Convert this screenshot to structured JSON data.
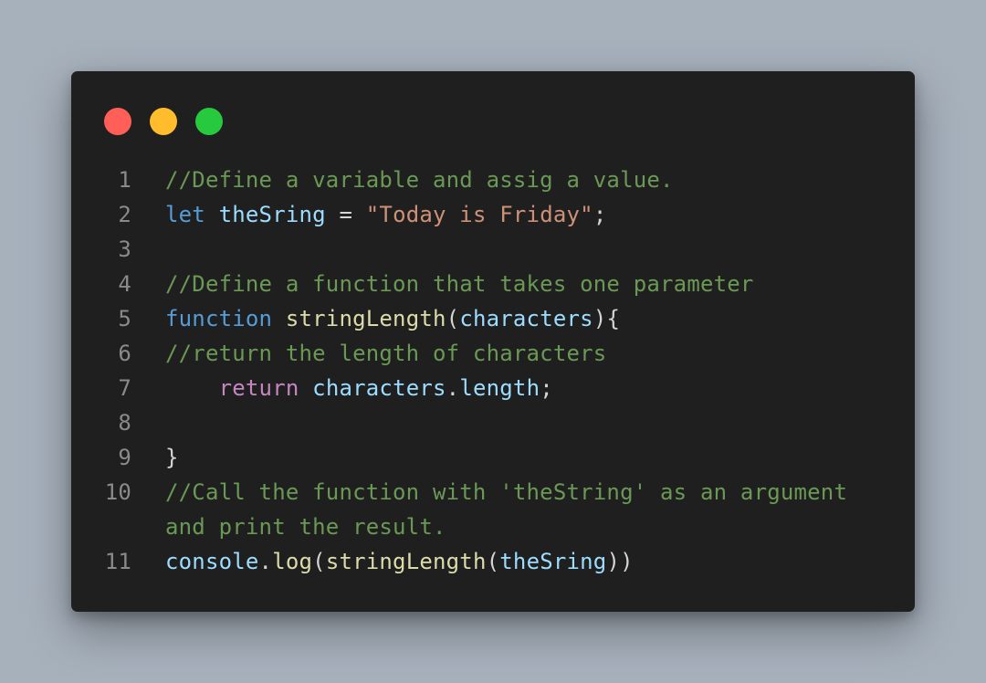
{
  "colors": {
    "background": "#a7b1bc",
    "window": "#1f1f1f",
    "dot_red": "#ff5f56",
    "dot_yellow": "#ffbd2e",
    "dot_green": "#27c93f"
  },
  "window_controls": [
    {
      "name": "close-dot",
      "color": "#ff5f56"
    },
    {
      "name": "minimize-dot",
      "color": "#ffbd2e"
    },
    {
      "name": "maximize-dot",
      "color": "#27c93f"
    }
  ],
  "code": {
    "lines": [
      {
        "number": "1",
        "tokens": [
          {
            "text": "//Define a variable and assig a value.",
            "type": "comment"
          }
        ]
      },
      {
        "number": "2",
        "tokens": [
          {
            "text": "let",
            "type": "keyword"
          },
          {
            "text": " ",
            "type": "plain"
          },
          {
            "text": "theSring",
            "type": "variable"
          },
          {
            "text": " = ",
            "type": "plain"
          },
          {
            "text": "\"Today is Friday\"",
            "type": "string"
          },
          {
            "text": ";",
            "type": "plain"
          }
        ]
      },
      {
        "number": "3",
        "tokens": []
      },
      {
        "number": "4",
        "tokens": [
          {
            "text": "//Define a function that takes one parameter",
            "type": "comment"
          }
        ]
      },
      {
        "number": "5",
        "tokens": [
          {
            "text": "function",
            "type": "keyword"
          },
          {
            "text": " ",
            "type": "plain"
          },
          {
            "text": "stringLength",
            "type": "function"
          },
          {
            "text": "(",
            "type": "plain"
          },
          {
            "text": "characters",
            "type": "variable"
          },
          {
            "text": "){",
            "type": "plain"
          }
        ]
      },
      {
        "number": "6",
        "tokens": [
          {
            "text": "//return the length of characters",
            "type": "comment"
          }
        ]
      },
      {
        "number": "7",
        "tokens": [
          {
            "text": "    ",
            "type": "plain"
          },
          {
            "text": "return",
            "type": "control"
          },
          {
            "text": " ",
            "type": "plain"
          },
          {
            "text": "characters",
            "type": "variable"
          },
          {
            "text": ".",
            "type": "plain"
          },
          {
            "text": "length",
            "type": "variable"
          },
          {
            "text": ";",
            "type": "plain"
          }
        ]
      },
      {
        "number": "8",
        "tokens": []
      },
      {
        "number": "9",
        "tokens": [
          {
            "text": "}",
            "type": "plain"
          }
        ]
      },
      {
        "number": "10",
        "tokens": [
          {
            "text": "//Call the function with 'theString' as an argument",
            "type": "comment"
          }
        ]
      },
      {
        "number": "",
        "tokens": [
          {
            "text": "and print the result.",
            "type": "comment"
          }
        ]
      },
      {
        "number": "11",
        "tokens": [
          {
            "text": "console",
            "type": "variable"
          },
          {
            "text": ".",
            "type": "plain"
          },
          {
            "text": "log",
            "type": "function"
          },
          {
            "text": "(",
            "type": "plain"
          },
          {
            "text": "stringLength",
            "type": "function"
          },
          {
            "text": "(",
            "type": "plain"
          },
          {
            "text": "theSring",
            "type": "variable"
          },
          {
            "text": "))",
            "type": "plain"
          }
        ]
      }
    ]
  }
}
